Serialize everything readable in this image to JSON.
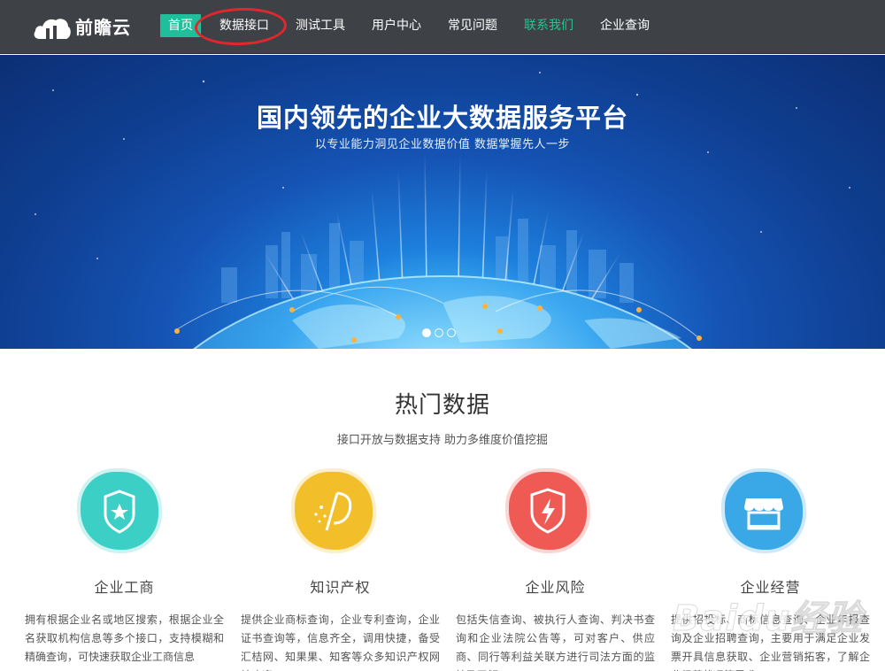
{
  "brand": {
    "name": "前瞻云"
  },
  "nav": {
    "items": [
      {
        "label": "首页"
      },
      {
        "label": "数据接口"
      },
      {
        "label": "测试工具"
      },
      {
        "label": "用户中心"
      },
      {
        "label": "常见问题"
      },
      {
        "label": "联系我们"
      },
      {
        "label": "企业查询"
      }
    ],
    "active_color": "#1fbf9b",
    "highlight_color": "#2ec08e",
    "annotation_color": "#e3262b"
  },
  "hero": {
    "title": "国内领先的企业大数据服务平台",
    "subtitle": "以专业能力洞见企业数据价值  数据掌握先人一步",
    "slides": 3,
    "active_slide": 1
  },
  "section": {
    "title": "热门数据",
    "subtitle": "接口开放与数据支持 助力多维度价值挖掘",
    "cards": [
      {
        "title": "企业工商",
        "icon": "police-badge-icon",
        "color": "#3ccfc6",
        "desc": "拥有根据企业名或地区搜索，根据企业全名获取机构信息等多个接口，支持模糊和精确查询，可快速获取企业工商信息"
      },
      {
        "title": "知识产权",
        "icon": "patent-road-icon",
        "color": "#f2bf2a",
        "desc": "提供企业商标查询，企业专利查询，企业证书查询等，信息齐全，调用快捷，备受汇桔网、知果果、知客等众多知识产权网站欢迎"
      },
      {
        "title": "企业风险",
        "icon": "lightning-shield-icon",
        "color": "#ef5a55",
        "desc": "包括失信查询、被执行人查询、判决书查询和企业法院公告等，可对客户、供应商、同行等利益关联方进行司法方面的监控及了解"
      },
      {
        "title": "企业经营",
        "icon": "storefront-icon",
        "color": "#3aa8e6",
        "desc": "提供招投标、商标信息查询、企业年报查询及企业招聘查询，主要用于满足企业发票开具信息获取、企业营销拓客，了解企业经营状况等需求"
      }
    ]
  },
  "watermark": {
    "text": "Baidu经验"
  }
}
